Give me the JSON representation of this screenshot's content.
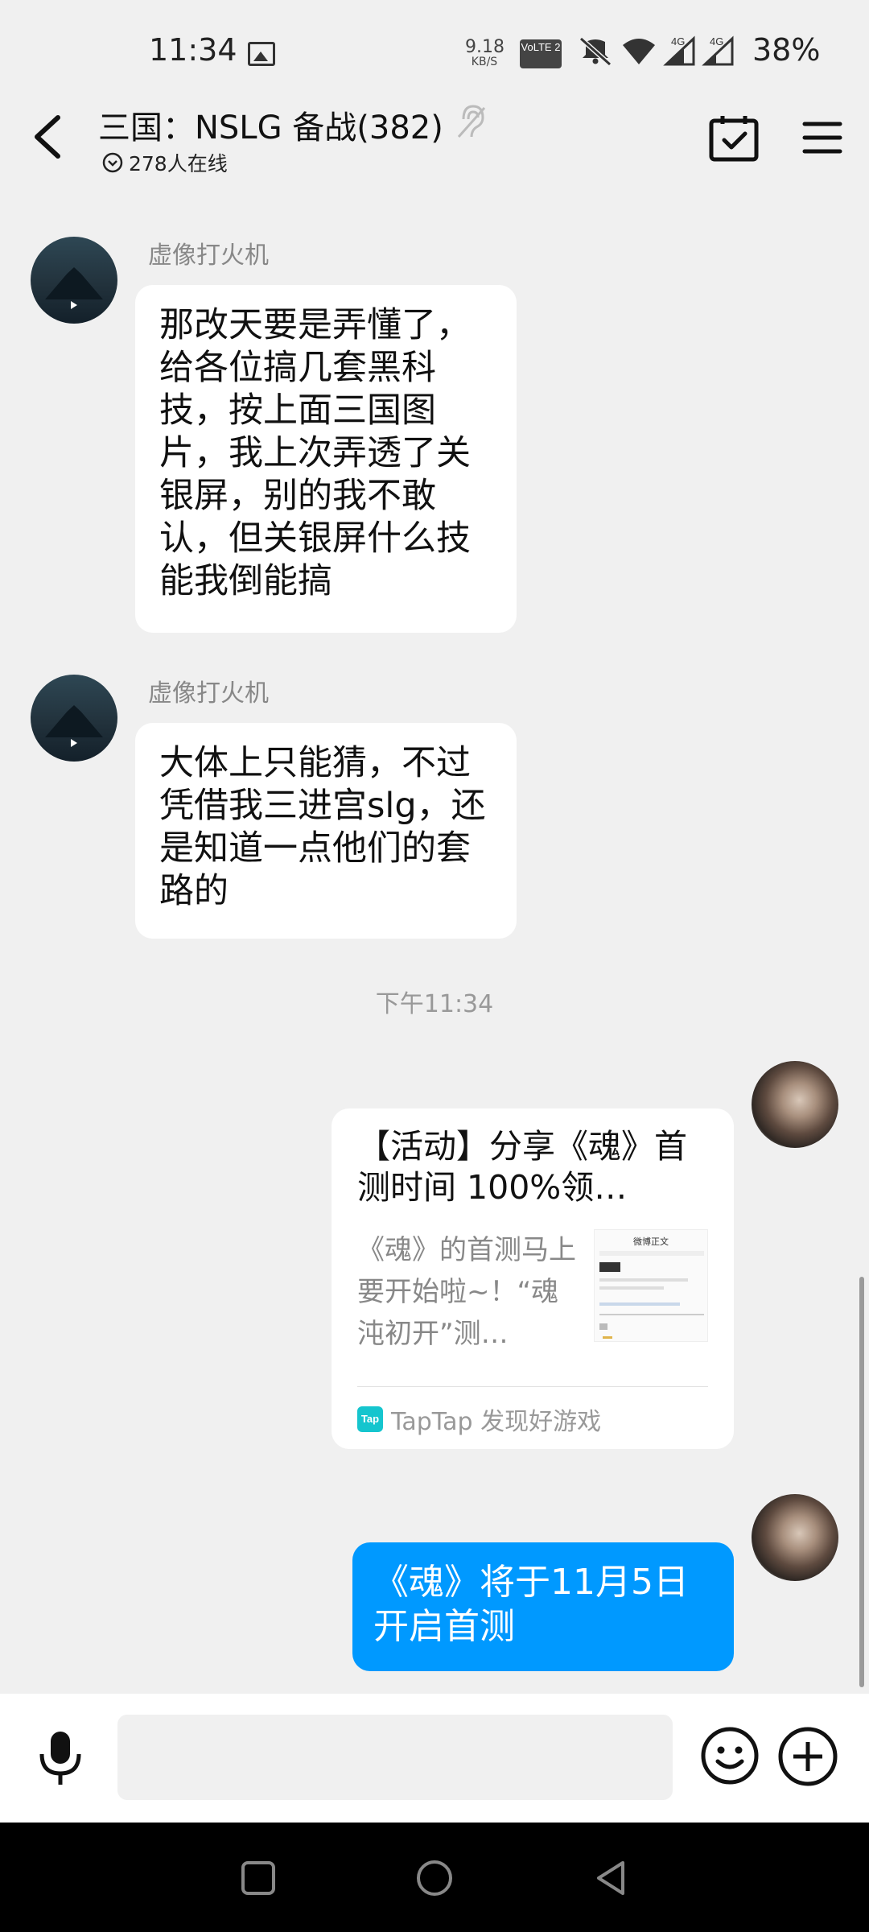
{
  "status_bar": {
    "time": "11:34",
    "speed_value": "9.18",
    "speed_unit": "KB/S",
    "volte_badge": "VoLTE 2",
    "network_left": "4G",
    "network_right": "4G",
    "battery": "38%"
  },
  "header": {
    "title": "三国：NSLG 备战(382)",
    "online_count": "278人在线"
  },
  "messages": [
    {
      "sender": "虚像打火机",
      "text": "那改天要是弄懂了，给各位搞几套黑科技，按上面三国图片，我上次弄透了关银屏，别的我不敢认，但关银屏什么技能我倒能搞"
    },
    {
      "sender": "虚像打火机",
      "text": "大体上只能猜，不过凭借我三进宫slg，还是知道一点他们的套路的"
    }
  ],
  "timestamp": "下午11:34",
  "share_card": {
    "title": "【活动】分享《魂》首测时间 100%领…",
    "description": "《魂》的首测马上要开始啦~！“魂沌初开”测…",
    "thumbnail_header": "微博正文",
    "source_badge": "Tap",
    "source": "TapTap 发现好游戏"
  },
  "outgoing_message": "《魂》将于11月5日开启首测",
  "input": {
    "value": ""
  },
  "colors": {
    "background": "#f0f0f0",
    "outgoing_bubble": "#0099ff",
    "incoming_bubble": "#ffffff",
    "taptap_brand": "#15c5ce"
  }
}
